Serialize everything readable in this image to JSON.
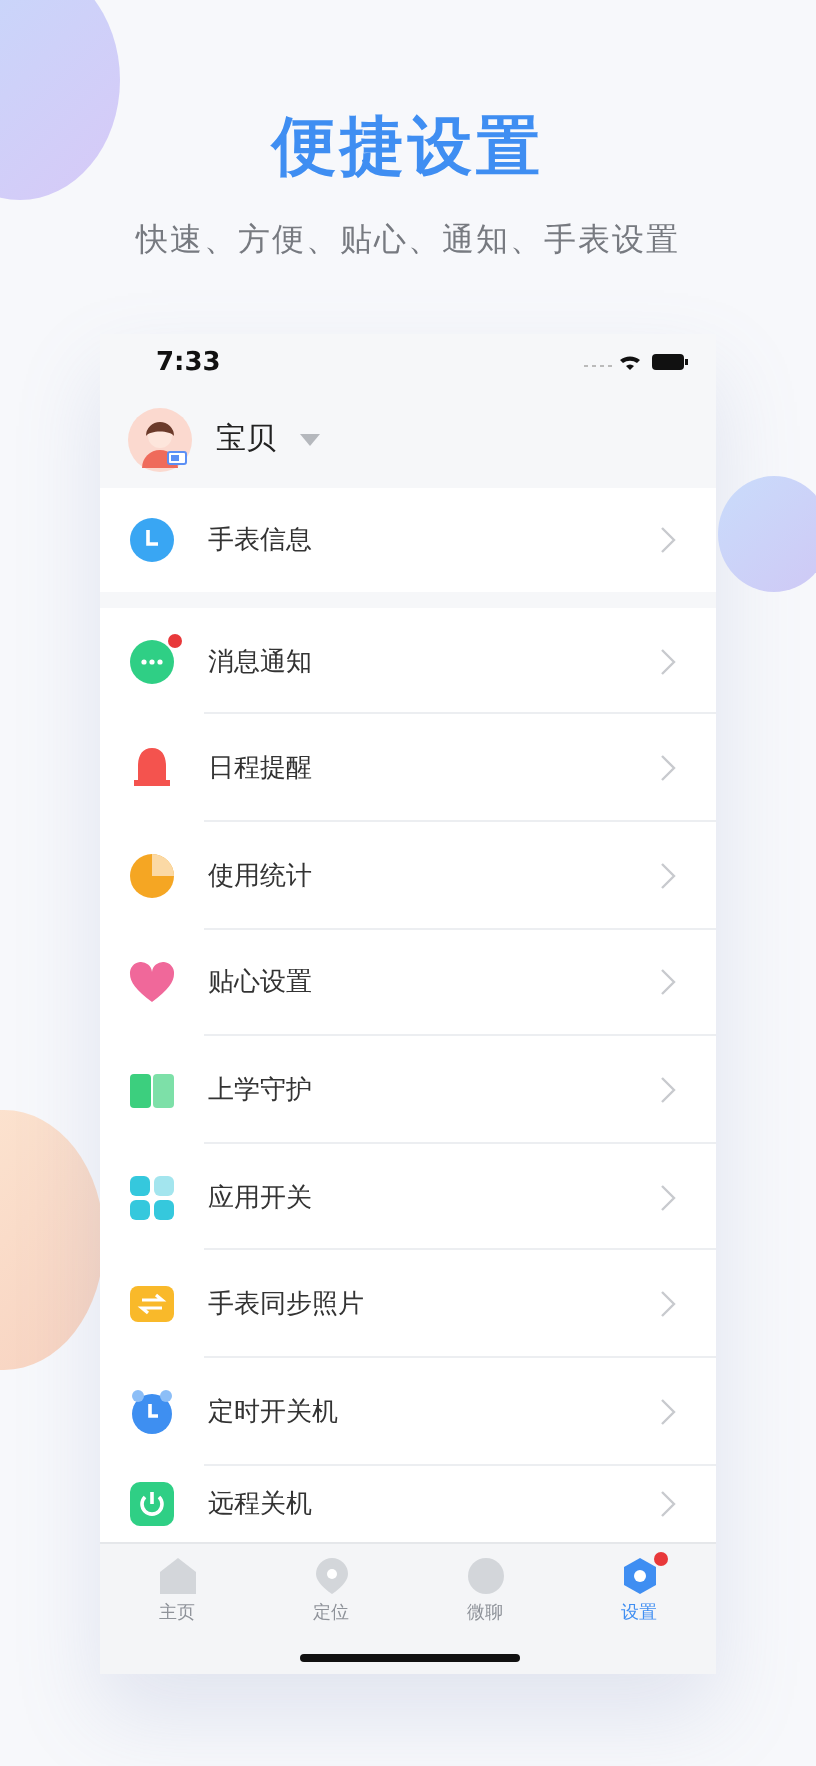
{
  "header": {
    "title": "便捷设置",
    "subtitle": "快速、方便、贴心、通知、手表设置"
  },
  "status_bar": {
    "time": "7:33"
  },
  "profile": {
    "name": "宝贝"
  },
  "watch_section": [
    {
      "label": "手表信息",
      "badge": false
    }
  ],
  "settings": [
    {
      "label": "消息通知",
      "badge": true
    },
    {
      "label": "日程提醒",
      "badge": false
    },
    {
      "label": "使用统计",
      "badge": false
    },
    {
      "label": "贴心设置",
      "badge": false
    },
    {
      "label": "上学守护",
      "badge": false
    },
    {
      "label": "应用开关",
      "badge": false
    },
    {
      "label": "手表同步照片",
      "badge": false
    },
    {
      "label": "定时开关机",
      "badge": false
    },
    {
      "label": "远程关机",
      "badge": false
    }
  ],
  "tab_bar": [
    {
      "label": "主页",
      "selected": false,
      "badge": false
    },
    {
      "label": "定位",
      "selected": false,
      "badge": false
    },
    {
      "label": "微聊",
      "selected": false,
      "badge": false
    },
    {
      "label": "设置",
      "selected": true,
      "badge": true
    }
  ]
}
